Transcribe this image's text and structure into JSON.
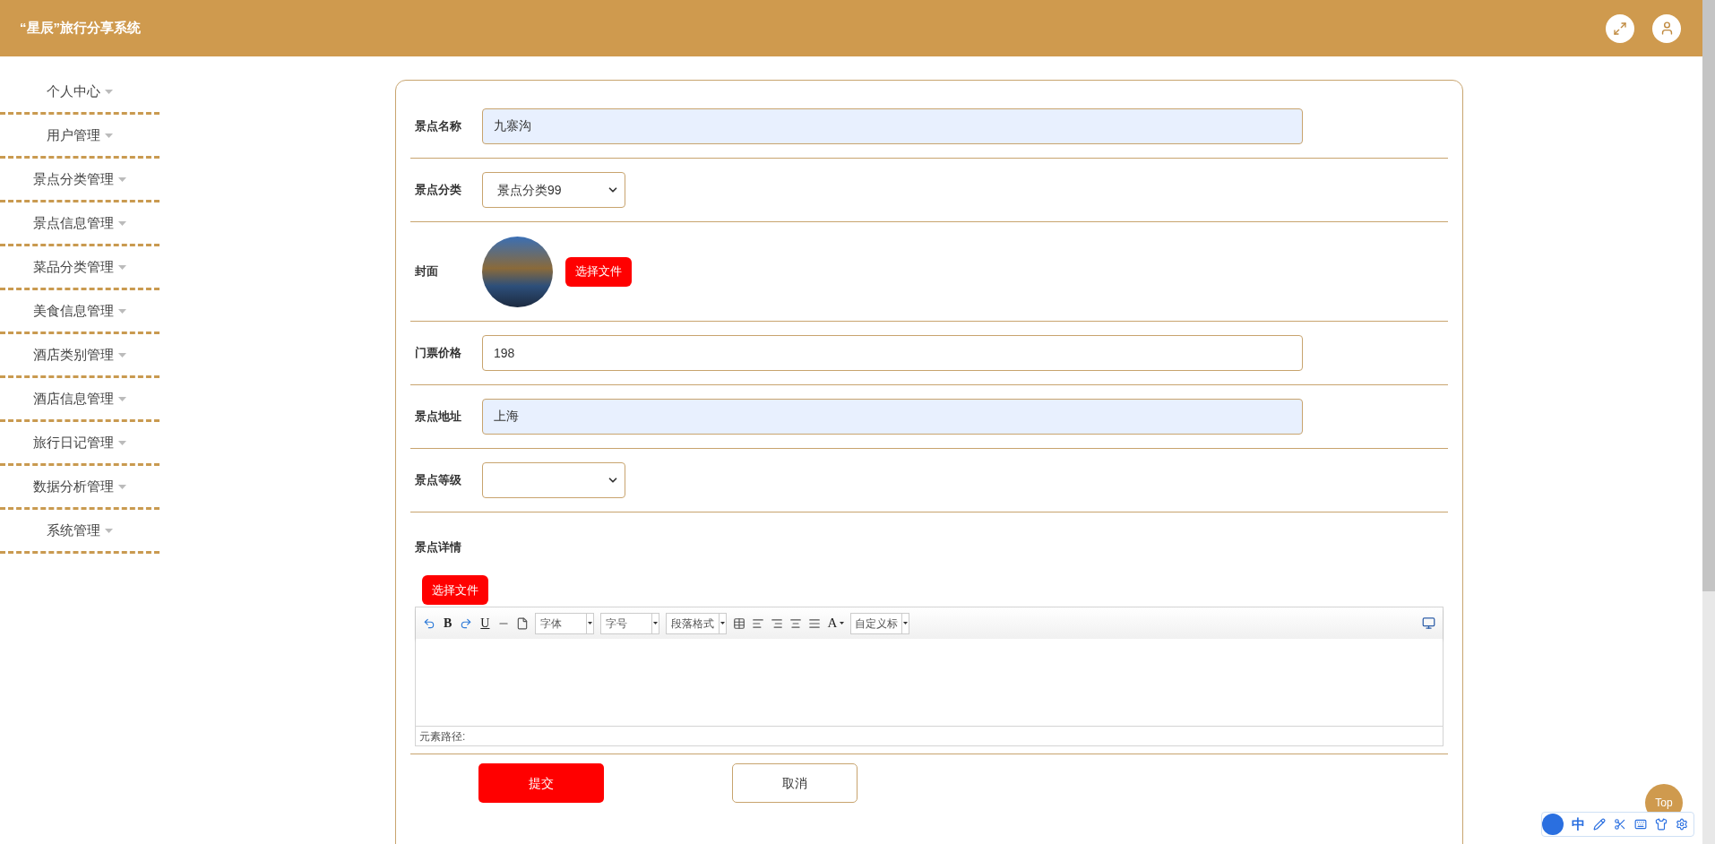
{
  "header": {
    "title": "“星辰”旅行分享系统"
  },
  "sidebar": {
    "items": [
      {
        "label": "个人中心"
      },
      {
        "label": "用户管理"
      },
      {
        "label": "景点分类管理"
      },
      {
        "label": "景点信息管理"
      },
      {
        "label": "菜品分类管理"
      },
      {
        "label": "美食信息管理"
      },
      {
        "label": "酒店类别管理"
      },
      {
        "label": "酒店信息管理"
      },
      {
        "label": "旅行日记管理"
      },
      {
        "label": "数据分析管理"
      },
      {
        "label": "系统管理"
      }
    ]
  },
  "form": {
    "fields": [
      {
        "kind": "text",
        "label": "景点名称",
        "value": "九寨沟",
        "autofilled": true
      },
      {
        "kind": "select",
        "label": "景点分类",
        "value": "景点分类99"
      },
      {
        "kind": "image",
        "label": "封面",
        "button": "选择文件"
      },
      {
        "kind": "text",
        "label": "门票价格",
        "value": "198",
        "autofilled": false
      },
      {
        "kind": "text",
        "label": "景点地址",
        "value": "上海",
        "autofilled": true
      },
      {
        "kind": "select",
        "label": "景点等级"
      }
    ],
    "details": {
      "label": "景点详情",
      "button": "选择文件",
      "bold": "B",
      "underline": "U",
      "font_color": "A",
      "dropdowns": [
        "字体",
        "字号",
        "段落格式"
      ],
      "custom_title": "自定义标",
      "path_label": "元素路径:"
    },
    "submit": "提交",
    "cancel": "取消"
  },
  "top_button": "Top",
  "ime": {
    "mode": "中"
  }
}
